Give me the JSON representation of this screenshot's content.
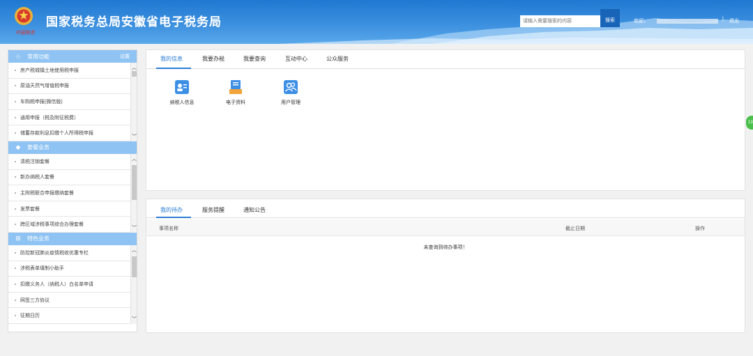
{
  "header": {
    "title": "国家税务总局安徽省电子税务局",
    "brand_sub": "中国税务",
    "search_placeholder": "请输入需要搜索的内容",
    "search_label": "搜索",
    "welcome": "欢迎，",
    "separator": "|",
    "logout": "退出"
  },
  "sidebar": {
    "common": {
      "title": "常用功能",
      "settings": "设置",
      "items": [
        "房产税城镇土地使用税申报",
        "原油天然气增值税申报",
        "车购税申报(微信版)",
        "通用申报（税及附征税费）",
        "储蓄存款利息扣缴个人所得税申报"
      ]
    },
    "package": {
      "title": "套餐业务",
      "items": [
        "清税注销套餐",
        "新办纳税人套餐",
        "主附税联合申报缴纳套餐",
        "发票套餐",
        "跨区域涉税事项综合办理套餐"
      ]
    },
    "special": {
      "title": "特色业务",
      "items": [
        "防控新冠肺炎疫情税收优惠专栏",
        "涉税表单填制小助手",
        "扣缴义务人（纳税人）白名单申请",
        "网签三方协议",
        "征期日历"
      ]
    }
  },
  "top_panel": {
    "tabs": [
      "我的信息",
      "我要办税",
      "我要查询",
      "互动中心",
      "公众服务"
    ],
    "functions": [
      {
        "label": "纳税人信息",
        "icon": "taxpayer-card-icon"
      },
      {
        "label": "电子资料",
        "icon": "document-stack-icon"
      },
      {
        "label": "用户管理",
        "icon": "users-icon"
      }
    ]
  },
  "bottom_panel": {
    "tabs": [
      "我的待办",
      "服务提醒",
      "通知公告"
    ],
    "columns": [
      "事项名称",
      "截止日期",
      "操作"
    ],
    "empty_text": "未查询到待办事项！"
  },
  "floating": {
    "label": "13"
  },
  "colors": {
    "header_blue": "#2a86db",
    "section_blue": "#8ec3f3",
    "accent": "#2a7cd4",
    "icon_blue": "#3d8fe6",
    "icon_orange": "#f2a33a"
  }
}
